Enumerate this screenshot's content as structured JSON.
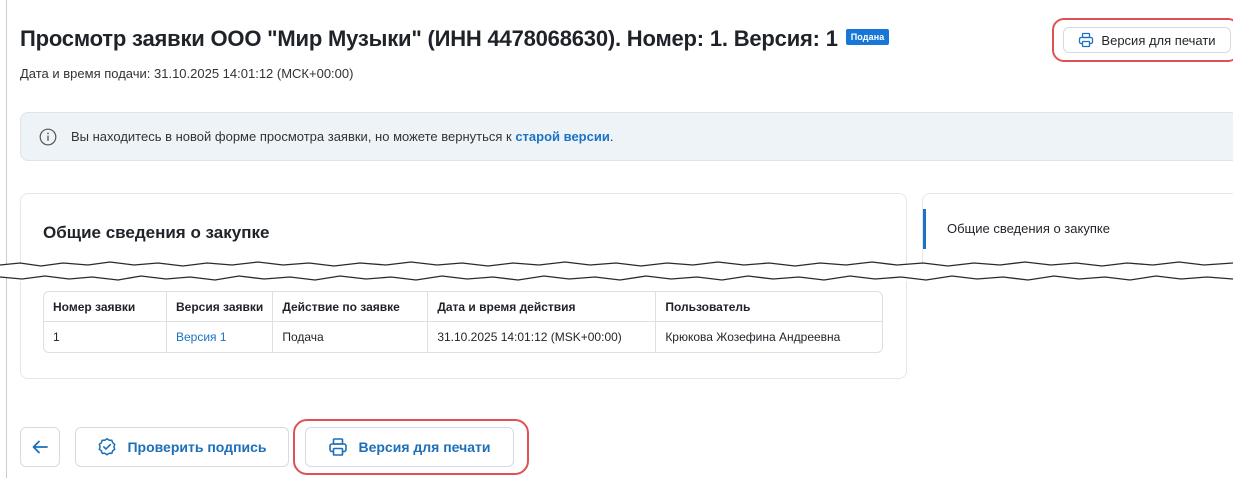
{
  "header": {
    "title": "Просмотр заявки ООО \"Мир Музыки\" (ИНН 4478068630). Номер: 1. Версия: 1",
    "status_badge": "Подана",
    "submitted_at": "Дата и время подачи: 31.10.2025 14:01:12 (МСК+00:00)",
    "print_button_label": "Версия для печати"
  },
  "banner": {
    "icon": "info-icon",
    "text_before_link": "Вы находитесь в новой форме просмотра заявки, но можете вернуться к ",
    "link_text": "старой версии",
    "text_after_link": "."
  },
  "section": {
    "title": "Общие сведения о закупке"
  },
  "side_nav": {
    "items": [
      {
        "label": "Общие сведения о закупке",
        "active": true
      }
    ]
  },
  "history_table": {
    "columns": [
      "Номер заявки",
      "Версия заявки",
      "Действие по заявке",
      "Дата и время действия",
      "Пользователь"
    ],
    "rows": [
      [
        "1",
        "Версия 1",
        "Подача",
        "31.10.2025 14:01:12 (MSK+00:00)",
        "Крюкова Жозефина Андреевна"
      ]
    ]
  },
  "footer": {
    "back_icon": "arrow-left-icon",
    "verify_label": "Проверить подпись",
    "verify_icon": "badge-check-icon",
    "print_label": "Версия для печати",
    "print_icon": "printer-icon"
  },
  "colors": {
    "accent": "#1c73c4",
    "badge": "#1677d6",
    "highlight": "#e05252",
    "banner_bg": "#eef3f7"
  }
}
